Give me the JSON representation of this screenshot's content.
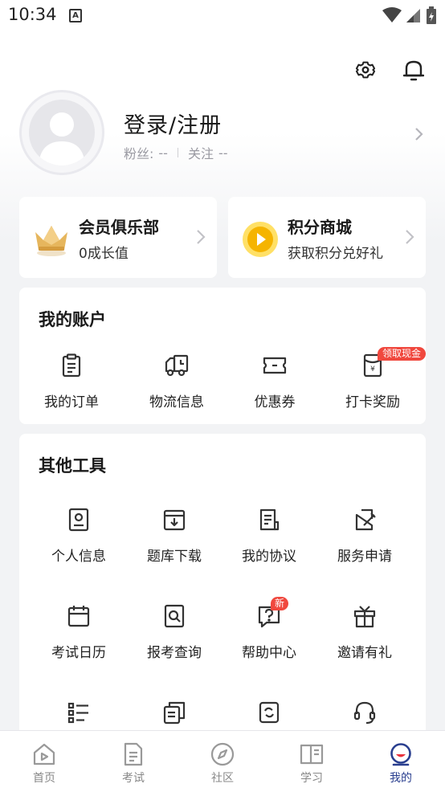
{
  "status_bar": {
    "time": "10:34",
    "notification_icon": "a-icon",
    "icons": [
      "wifi-icon",
      "signal-icon",
      "battery-icon"
    ]
  },
  "header": {
    "icons": [
      "settings-icon",
      "bell-icon"
    ]
  },
  "profile": {
    "title": "登录/注册",
    "fans_label": "粉丝:",
    "fans_value": "--",
    "follow_label": "关注",
    "follow_value": "--"
  },
  "cards": [
    {
      "title": "会员俱乐部",
      "subtitle": "0成长值",
      "icon": "crown-icon"
    },
    {
      "title": "积分商城",
      "subtitle": "获取积分兑好礼",
      "icon": "coin-play-icon"
    }
  ],
  "account": {
    "title": "我的账户",
    "items": [
      {
        "label": "我的订单",
        "icon": "clipboard-icon"
      },
      {
        "label": "物流信息",
        "icon": "truck-icon"
      },
      {
        "label": "优惠券",
        "icon": "coupon-icon"
      },
      {
        "label": "打卡奖励",
        "icon": "red-envelope-icon",
        "badge": "领取现金"
      }
    ]
  },
  "tools": {
    "title": "其他工具",
    "items": [
      {
        "label": "个人信息",
        "icon": "id-card-icon"
      },
      {
        "label": "题库下载",
        "icon": "download-box-icon"
      },
      {
        "label": "我的协议",
        "icon": "document-icon"
      },
      {
        "label": "服务申请",
        "icon": "edit-icon"
      },
      {
        "label": "考试日历",
        "icon": "calendar-icon"
      },
      {
        "label": "报考查询",
        "icon": "search-doc-icon"
      },
      {
        "label": "帮助中心",
        "icon": "help-icon",
        "badge": "新"
      },
      {
        "label": "邀请有礼",
        "icon": "gift-icon"
      },
      {
        "label": "",
        "icon": "list-icon"
      },
      {
        "label": "",
        "icon": "copy-icon"
      },
      {
        "label": "",
        "icon": "refresh-doc-icon"
      },
      {
        "label": "",
        "icon": "headset-icon"
      }
    ]
  },
  "tabbar": {
    "active_color": "#2a3f8f",
    "tabs": [
      {
        "label": "首页",
        "icon": "home-icon"
      },
      {
        "label": "考试",
        "icon": "exam-icon"
      },
      {
        "label": "社区",
        "icon": "compass-icon"
      },
      {
        "label": "学习",
        "icon": "book-icon"
      },
      {
        "label": "我的",
        "icon": "profile-icon",
        "active": true
      }
    ]
  }
}
